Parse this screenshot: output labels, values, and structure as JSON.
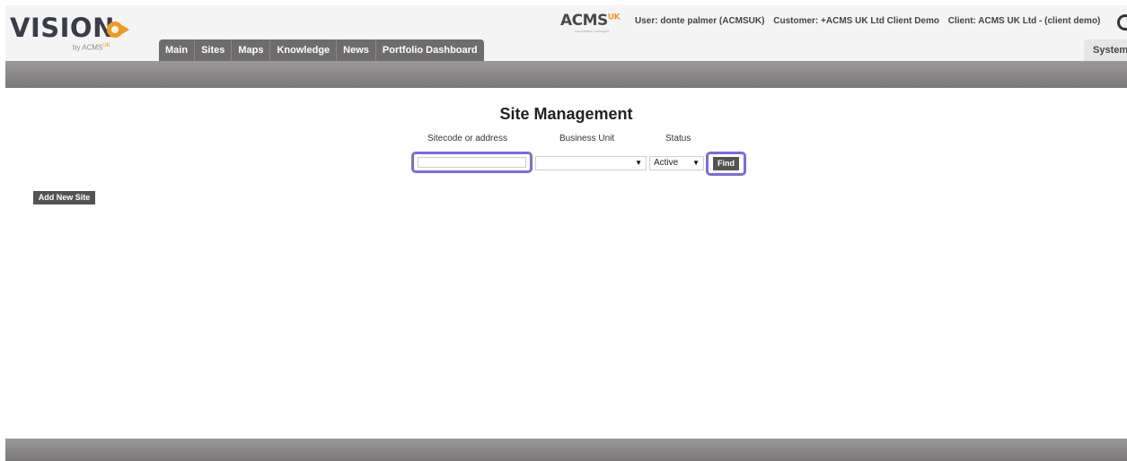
{
  "brand": {
    "logo_text": "VISION",
    "logo_sub": "by ACMS",
    "logo_sup": "UK",
    "partner_logo": "ACMS",
    "partner_sup": "UK",
    "partner_tag": "compliance managed"
  },
  "nav": {
    "tabs": [
      {
        "label": "Main"
      },
      {
        "label": "Sites"
      },
      {
        "label": "Maps"
      },
      {
        "label": "Knowledge"
      },
      {
        "label": "News"
      },
      {
        "label": "Portfolio Dashboard"
      }
    ],
    "system_tab": "System"
  },
  "user_info": {
    "user": "User: donte palmer (ACMSUK)",
    "customer": "Customer: +ACMS UK Ltd Client Demo",
    "client": "Client: ACMS UK Ltd - (client demo)"
  },
  "main": {
    "title": "Site Management",
    "search_label": "Sitecode or address",
    "search_value": "",
    "business_unit_label": "Business Unit",
    "business_unit_value": "",
    "status_label": "Status",
    "status_value": "Active",
    "find_label": "Find",
    "add_site_label": "Add New Site"
  },
  "icons": {
    "dropdown": "chevron-down-icon",
    "loading": "loading-icon"
  },
  "colors": {
    "accent_orange": "#f09a1f",
    "nav_bg": "#6f6c6d",
    "highlight": "#7a6be0",
    "button_bg": "#555253"
  }
}
